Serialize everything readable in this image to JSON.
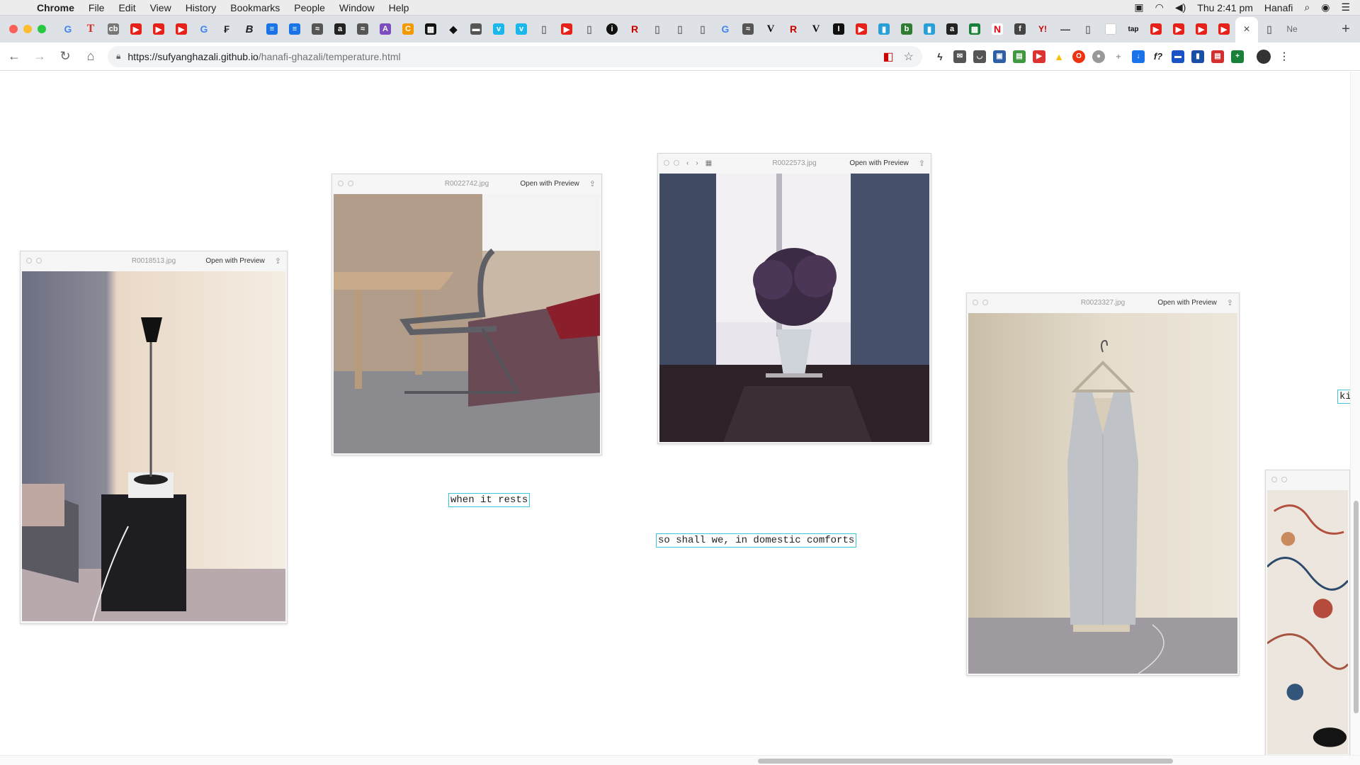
{
  "menubar": {
    "app": "Chrome",
    "items": [
      "File",
      "Edit",
      "View",
      "History",
      "Bookmarks",
      "People",
      "Window",
      "Help"
    ],
    "clock": "Thu 2:41 pm",
    "user": "Hanafi"
  },
  "tabs": {
    "active_close": "×",
    "last_tab_label": "Ne",
    "new_tab": "+"
  },
  "toolbar": {
    "url_host": "https://sufyanghazali.github.io",
    "url_path": "/hanafi-ghazali/temperature.html"
  },
  "page": {
    "windows": [
      {
        "filename": "R0018513.jpg",
        "open_label": "Open with Preview"
      },
      {
        "filename": "R0022742.jpg",
        "open_label": "Open with Preview"
      },
      {
        "filename": "R0022573.jpg",
        "open_label": "Open with Preview"
      },
      {
        "filename": "R0023327.jpg",
        "open_label": "Open with Preview"
      }
    ],
    "captions": {
      "c1": "when it rests",
      "c2": "so shall we, in domestic comforts",
      "c3": "ki"
    }
  },
  "colors": {
    "caption_border": "#3cc6d9",
    "traffic_close": "#fe5f57",
    "traffic_min": "#febc2e",
    "traffic_max": "#28c840"
  }
}
